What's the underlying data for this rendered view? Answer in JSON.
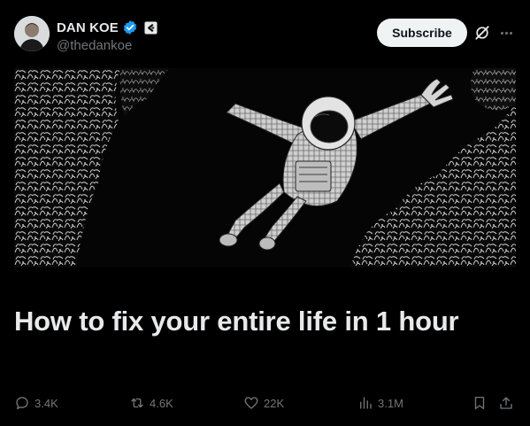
{
  "author": {
    "display_name": "DAN KOE",
    "handle": "@thedankoe",
    "verified": true
  },
  "header": {
    "subscribe_label": "Subscribe"
  },
  "article": {
    "title": "How to fix your entire life in 1 hour",
    "image_subject": "astronaut-illustration"
  },
  "metrics": {
    "replies": "3.4K",
    "reposts": "4.6K",
    "likes": "22K",
    "views": "3.1M"
  },
  "colors": {
    "background": "#000000",
    "text": "#e7e9ea",
    "muted": "#71767b",
    "verified_blue": "#1d9bf0",
    "subscribe_bg": "#eff3f4"
  }
}
